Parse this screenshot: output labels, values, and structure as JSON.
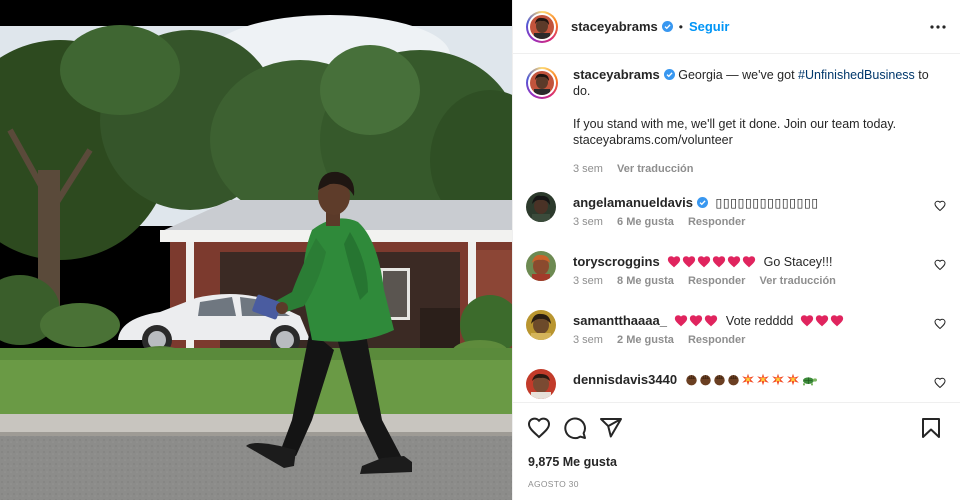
{
  "post": {
    "author": {
      "username": "staceyabrams",
      "follow_label": "Seguir",
      "separator": "•",
      "verified_icon": "verified-badge-icon",
      "more_icon": "more-options-icon"
    },
    "caption": {
      "username": "staceyabrams",
      "text_before_tag": "Georgia — we've got ",
      "hashtag": "#UnfinishedBusiness",
      "text_after_tag": " to do.",
      "paragraph2": "If you stand with me, we'll get it done. Join our team today. staceyabrams.com/volunteer",
      "age": "3 sem",
      "translate_label": "Ver traducción"
    },
    "comments": [
      {
        "username": "angelamanueldavis",
        "verified": true,
        "text": "▯▯▯▯▯▯▯▯▯▯▯▯▯▯",
        "emojis": [],
        "age": "3 sem",
        "likes_label": "6 Me gusta",
        "reply_label": "Responder",
        "translate_label": ""
      },
      {
        "username": "toryscroggins",
        "verified": false,
        "text": "Go Stacey!!!",
        "emojis": [
          "heart",
          "heart",
          "heart",
          "heart",
          "heart",
          "heart"
        ],
        "age": "3 sem",
        "likes_label": "8 Me gusta",
        "reply_label": "Responder",
        "translate_label": "Ver traducción"
      },
      {
        "username": "samantthaaaa_",
        "verified": false,
        "text": "Vote redddd",
        "emojis": [
          "heart",
          "heart",
          "heart"
        ],
        "emojis_after": [
          "heart",
          "heart",
          "heart"
        ],
        "age": "3 sem",
        "likes_label": "2 Me gusta",
        "reply_label": "Responder",
        "translate_label": ""
      },
      {
        "username": "dennisdavis3440",
        "verified": false,
        "text": "",
        "emojis": [
          "fist",
          "fist",
          "fist",
          "fist",
          "boom",
          "boom",
          "boom",
          "boom",
          "turtle"
        ],
        "age": "",
        "likes_label": "",
        "reply_label": "",
        "translate_label": ""
      }
    ],
    "actions": {
      "like_icon": "heart-outline-icon",
      "comment_icon": "comment-icon",
      "share_icon": "share-icon",
      "save_icon": "bookmark-icon"
    },
    "likes_label": "9,875 Me gusta",
    "date_label": "AGOSTO 30"
  },
  "colors": {
    "link_blue": "#0095f6",
    "hashtag": "#00376b",
    "muted": "#8e8e8e",
    "heart_red": "#e0245e",
    "verified_blue": "#3897f0"
  }
}
